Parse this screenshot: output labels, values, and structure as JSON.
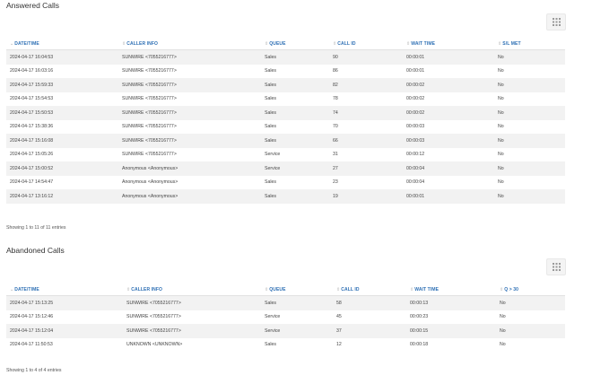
{
  "answered": {
    "title": "Answered Calls",
    "columns": [
      "DATE/TIME",
      "CALLER INFO",
      "QUEUE",
      "CALL ID",
      "WAIT TIME",
      "S/L MET"
    ],
    "rows": [
      [
        "2024-04-17 16:04:53",
        "SUNWIRE <7055216777>",
        "Sales",
        "90",
        "00:00:01",
        "No"
      ],
      [
        "2024-04-17 16:03:16",
        "SUNWIRE <7055216777>",
        "Sales",
        "86",
        "00:00:01",
        "No"
      ],
      [
        "2024-04-17 15:59:33",
        "SUNWIRE <7055216777>",
        "Sales",
        "82",
        "00:00:02",
        "No"
      ],
      [
        "2024-04-17 15:54:53",
        "SUNWIRE <7055216777>",
        "Sales",
        "78",
        "00:00:02",
        "No"
      ],
      [
        "2024-04-17 15:50:53",
        "SUNWIRE <7055216777>",
        "Sales",
        "74",
        "00:00:02",
        "No"
      ],
      [
        "2024-04-17 15:38:36",
        "SUNWIRE <7055216777>",
        "Sales",
        "70",
        "00:00:03",
        "No"
      ],
      [
        "2024-04-17 15:16:08",
        "SUNWIRE <7055216777>",
        "Sales",
        "66",
        "00:00:03",
        "No"
      ],
      [
        "2024-04-17 15:05:26",
        "SUNWIRE <7055216777>",
        "Service",
        "31",
        "00:00:12",
        "No"
      ],
      [
        "2024-04-17 15:00:52",
        "Anonymous <Anonymous>",
        "Service",
        "27",
        "00:00:04",
        "No"
      ],
      [
        "2024-04-17 14:54:47",
        "Anonymous <Anonymous>",
        "Sales",
        "23",
        "00:00:04",
        "No"
      ],
      [
        "2024-04-17 13:16:12",
        "Anonymous <Anonymous>",
        "Sales",
        "19",
        "00:00:01",
        "No"
      ]
    ],
    "info": "Showing 1 to 11 of 11 entries"
  },
  "abandoned": {
    "title": "Abandoned Calls",
    "columns": [
      "DATE/TIME",
      "CALLER INFO",
      "QUEUE",
      "CALL ID",
      "WAIT TIME",
      "Q > 30"
    ],
    "rows": [
      [
        "2024-04-17 15:13:25",
        "SUNWIRE <7055216777>",
        "Sales",
        "58",
        "00:00:13",
        "No"
      ],
      [
        "2024-04-17 15:12:46",
        "SUNWIRE <7055216777>",
        "Service",
        "45",
        "00:00:23",
        "No"
      ],
      [
        "2024-04-17 15:12:04",
        "SUNWIRE <7055216777>",
        "Service",
        "37",
        "00:00:15",
        "No"
      ],
      [
        "2024-04-17 11:50:53",
        "UNKNOWN <UNKNOWN>",
        "Sales",
        "12",
        "00:00:18",
        "No"
      ]
    ],
    "info": "Showing 1 to 4 of 4 entries"
  },
  "icons": {
    "columns_toggle": "grid-icon",
    "sort_descending": "sort-down-icon",
    "sort_both": "sort-both-icon"
  },
  "colors": {
    "header_text": "#2d6fb4",
    "stripe": "#f2f2f2"
  }
}
